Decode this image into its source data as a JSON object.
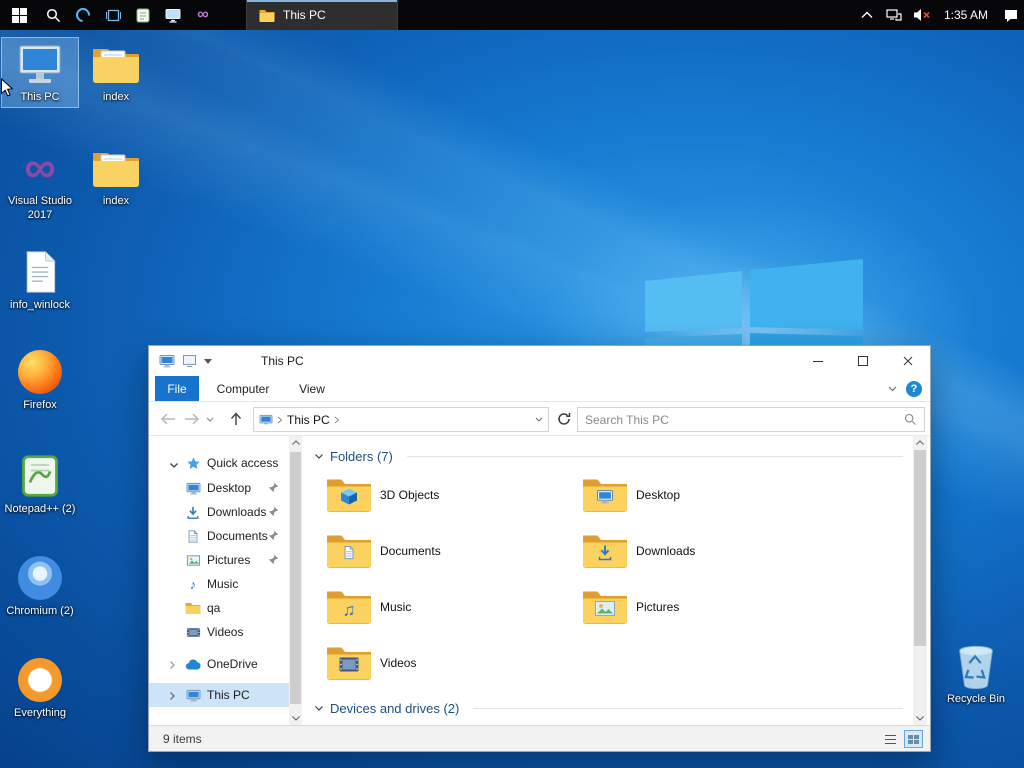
{
  "taskbar": {
    "task_button": {
      "label": "This PC"
    },
    "clock": "1:35 AM"
  },
  "desktop": {
    "icons": [
      {
        "label": "This PC"
      },
      {
        "label": "index"
      },
      {
        "label": "Visual Studio 2017"
      },
      {
        "label": "index"
      },
      {
        "label": "info_winlock"
      },
      {
        "label": "Firefox"
      },
      {
        "label": "Notepad++ (2)"
      },
      {
        "label": "Chromium (2)"
      },
      {
        "label": "Everything"
      },
      {
        "label": "Recycle Bin"
      }
    ]
  },
  "explorer": {
    "title": "This PC",
    "ribbon": {
      "file": "File",
      "computer": "Computer",
      "view": "View"
    },
    "address": {
      "location": "This PC"
    },
    "search": {
      "placeholder": "Search This PC"
    },
    "sidebar": {
      "quick_access": "Quick access",
      "items": [
        {
          "label": "Desktop"
        },
        {
          "label": "Downloads"
        },
        {
          "label": "Documents"
        },
        {
          "label": "Pictures"
        },
        {
          "label": "Music"
        },
        {
          "label": "qa"
        },
        {
          "label": "Videos"
        }
      ],
      "onedrive": "OneDrive",
      "this_pc": "This PC"
    },
    "content": {
      "folders_header": "Folders (7)",
      "folders": [
        {
          "name": "3D Objects"
        },
        {
          "name": "Desktop"
        },
        {
          "name": "Documents"
        },
        {
          "name": "Downloads"
        },
        {
          "name": "Music"
        },
        {
          "name": "Pictures"
        },
        {
          "name": "Videos"
        }
      ],
      "devices_header": "Devices and drives (2)"
    },
    "status": {
      "items": "9 items"
    }
  },
  "icons": {
    "visual_studio_glyph": "∞",
    "music_note": "♪",
    "music_note_double": "♫"
  }
}
